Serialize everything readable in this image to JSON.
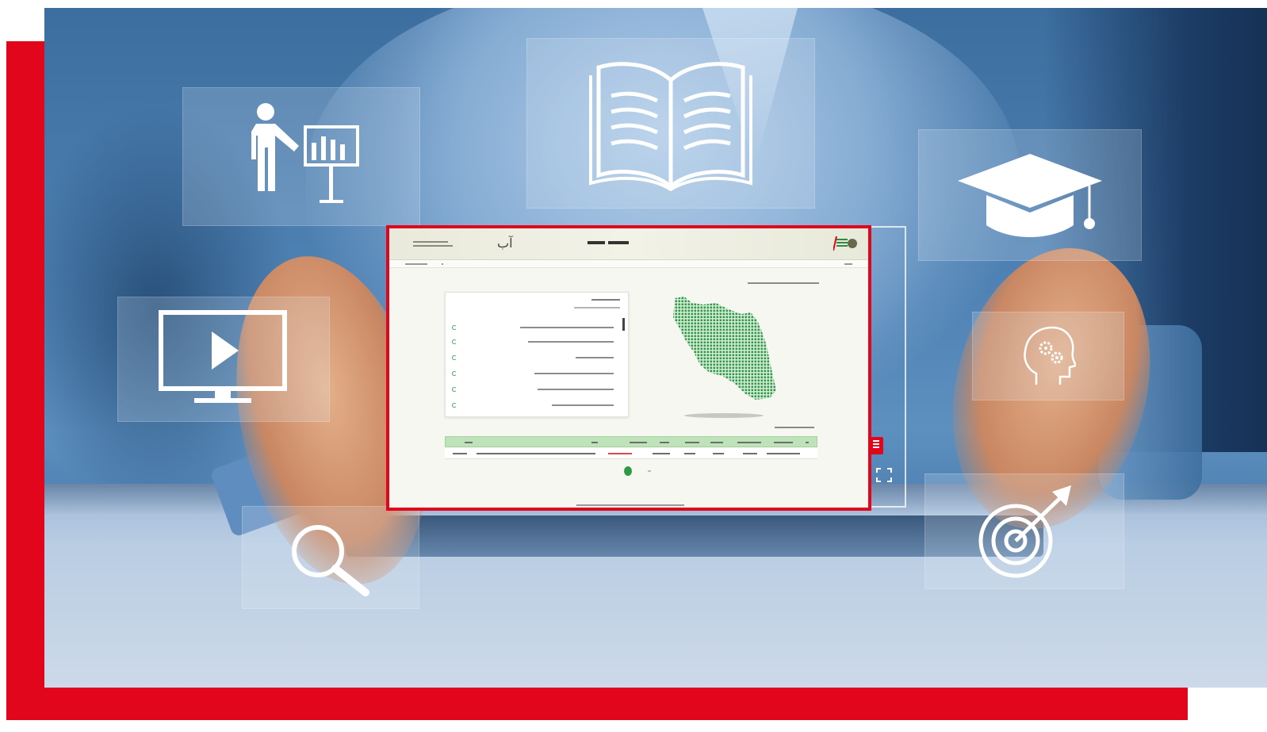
{
  "scene": {
    "accent_color": "#e1061b",
    "icon_cards": [
      {
        "name": "presenter-chart-icon"
      },
      {
        "name": "open-book-icon"
      },
      {
        "name": "graduation-cap-icon"
      },
      {
        "name": "video-play-monitor-icon"
      },
      {
        "name": "head-gears-icon"
      },
      {
        "name": "magnifier-search-icon"
      },
      {
        "name": "target-dart-icon"
      }
    ]
  },
  "mockup": {
    "logo_glyph": "آب",
    "header_accent": "#e1061b",
    "map_color": "#2e9a47",
    "table_header_color": "#bfe3b8"
  }
}
